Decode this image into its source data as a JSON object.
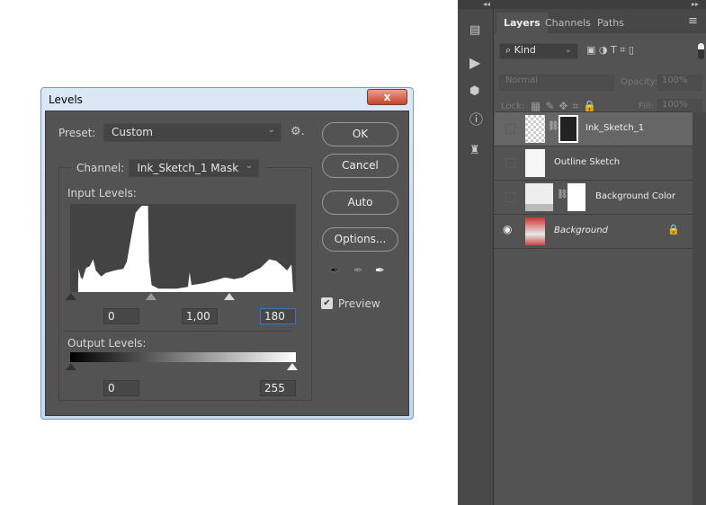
{
  "dialog": {
    "title": "Levels",
    "close": "x",
    "preset_label": "Preset:",
    "preset_value": "Custom",
    "channel_label": "Channel:",
    "channel_value": "Ink_Sketch_1 Mask",
    "input_label": "Input Levels:",
    "input_values": [
      "0",
      "1,00",
      "180"
    ],
    "output_label": "Output Levels:",
    "output_values": [
      "0",
      "255"
    ],
    "buttons": {
      "ok": "OK",
      "cancel": "Cancel",
      "auto": "Auto",
      "options": "Options..."
    },
    "preview_label": "Preview",
    "preview_checked": true
  },
  "histogram": [
    [
      9,
      0.1
    ],
    [
      9.5,
      0.27
    ],
    [
      12,
      0.17
    ],
    [
      14,
      0.15
    ],
    [
      18,
      0.28
    ],
    [
      22,
      0.3
    ],
    [
      26,
      0.38
    ],
    [
      29,
      0.25
    ],
    [
      35,
      0.18
    ],
    [
      40,
      0.22
    ],
    [
      50,
      0.25
    ],
    [
      60,
      0.27
    ],
    [
      64,
      0.35
    ],
    [
      70,
      0.7
    ],
    [
      74,
      0.92
    ],
    [
      78,
      0.97
    ],
    [
      81,
      1.0
    ],
    [
      88,
      1.0
    ],
    [
      89,
      0.35
    ],
    [
      92,
      0.08
    ],
    [
      100,
      0.04
    ],
    [
      120,
      0.04
    ],
    [
      133,
      0.06
    ],
    [
      135,
      0.23
    ],
    [
      137,
      0.08
    ],
    [
      150,
      0.1
    ],
    [
      165,
      0.14
    ],
    [
      175,
      0.17
    ],
    [
      185,
      0.15
    ],
    [
      195,
      0.17
    ],
    [
      203,
      0.22
    ],
    [
      215,
      0.28
    ],
    [
      225,
      0.38
    ],
    [
      233,
      0.36
    ],
    [
      240,
      0.3
    ],
    [
      245,
      0.25
    ],
    [
      250,
      0.32
    ],
    [
      252,
      0
    ]
  ],
  "panel": {
    "collapse_left": "◂◂",
    "collapse_right": "▸▸",
    "tabs": [
      "Layers",
      "Channels",
      "Paths"
    ],
    "filter": "Kind",
    "blend": "Normal",
    "opacity_label": "Opacity:",
    "opacity": "100%",
    "lock_label": "Lock:",
    "fill_label": "Fill:",
    "fill": "100%",
    "layers": [
      {
        "name": "Ink_Sketch_1",
        "visible": false,
        "selected": true
      },
      {
        "name": "Outline Sketch",
        "visible": false
      },
      {
        "name": "Background Color",
        "visible": false
      },
      {
        "name": "Background",
        "visible": true,
        "locked": true
      }
    ]
  }
}
